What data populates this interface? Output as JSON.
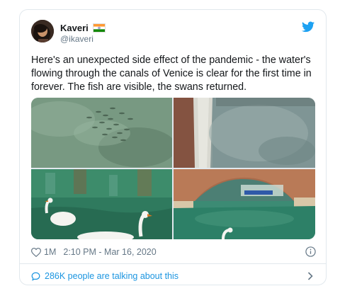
{
  "tweet": {
    "author": {
      "display_name": "Kaveri",
      "handle": "@ikaveri",
      "flag_icon": "india-flag-icon"
    },
    "text": "Here's an unexpected side effect of the pandemic - the water's flowing through the canals of Venice is clear for the first time in forever. The fish are visible, the swans returned.",
    "media": [
      {
        "label": "fish-in-clear-water-photo"
      },
      {
        "label": "canal-clear-water-photo"
      },
      {
        "label": "swans-in-canal-photo"
      },
      {
        "label": "bridge-over-canal-photo"
      }
    ],
    "likes": "1M",
    "timestamp": "2:10 PM - Mar 16, 2020",
    "footer_text": "286K people are talking about this"
  },
  "colors": {
    "brand": "#1da1f2",
    "link": "#1b95e0",
    "muted": "#657786"
  }
}
